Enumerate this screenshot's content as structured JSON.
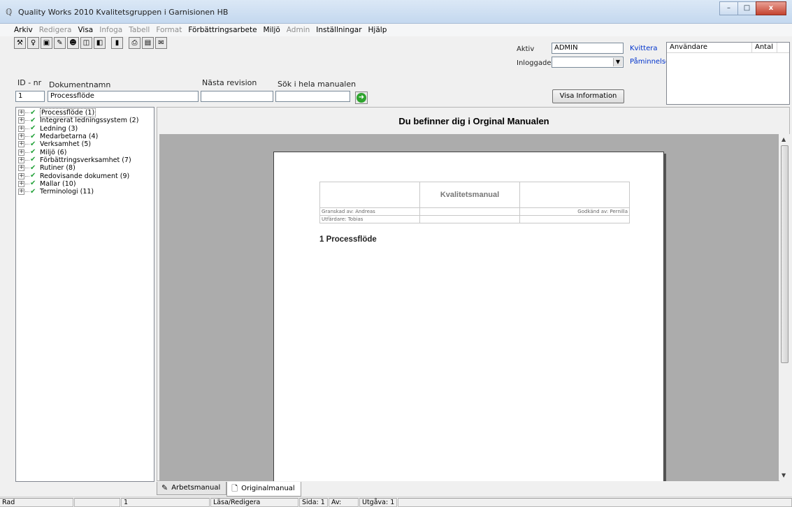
{
  "window": {
    "title": "Quality Works 2010 Kvalitetsgruppen i Garnisionen HB",
    "min": "–",
    "max": "□",
    "close": "x"
  },
  "menu": [
    {
      "label": "Arkiv",
      "enabled": true
    },
    {
      "label": "Redigera",
      "enabled": false
    },
    {
      "label": "Visa",
      "enabled": true
    },
    {
      "label": "Infoga",
      "enabled": false
    },
    {
      "label": "Tabell",
      "enabled": false
    },
    {
      "label": "Format",
      "enabled": false
    },
    {
      "label": "Förbättringsarbete",
      "enabled": true
    },
    {
      "label": "Miljö",
      "enabled": true
    },
    {
      "label": "Admin",
      "enabled": false
    },
    {
      "label": "Inställningar",
      "enabled": true
    },
    {
      "label": "Hjälp",
      "enabled": true
    }
  ],
  "toolbar": [
    "⚒",
    "♀",
    "▣",
    "✎",
    "☻",
    "◫",
    "◧",
    "▮",
    "⎙",
    "▤",
    "✉"
  ],
  "fields": {
    "id_label": "ID - nr",
    "id_value": "1",
    "name_label": "Dokumentnamn",
    "name_value": "Processflöde",
    "revision_label": "Nästa revision",
    "revision_value": "",
    "search_label": "Sök i hela manualen",
    "search_value": ""
  },
  "session": {
    "active_label": "Aktiv",
    "active_value": "ADMIN",
    "logged_label": "Inloggade",
    "logged_value": "",
    "acknowledge_link": "Kvittera",
    "reminder_link": "Påminnelse",
    "info_button": "Visa Information"
  },
  "users_table": {
    "col_user": "Användare",
    "col_count": "Antal"
  },
  "tree": [
    "Processflöde (1)",
    "Integrerat ledningssystem (2)",
    "Ledning (3)",
    "Medarbetarna (4)",
    "Verksamhet (5)",
    "Miljö (6)",
    "Förbättringsverksamhet (7)",
    "Rutiner (8)",
    "Redovisande dokument (9)",
    "Mallar (10)",
    "Terminologi (11)"
  ],
  "main": {
    "heading": "Du befinner dig i Orginal Manualen",
    "doc_title": "Kvalitetsmanual",
    "reviewed_by": "Granskad av: Andreas",
    "approved_by": "Godkänd av: Pernilla",
    "issued_by": "Utfärdare: Tobias",
    "section_heading": "1 Processflöde"
  },
  "tabs": {
    "work": "Arbetsmanual",
    "original": "Originalmanual"
  },
  "status": {
    "row": "Rad",
    "blank": "",
    "value": "1",
    "mode": "Läsa/Redigera",
    "page": "Sida: 1",
    "of": "Av:",
    "edition": "Utgåva: 1"
  }
}
